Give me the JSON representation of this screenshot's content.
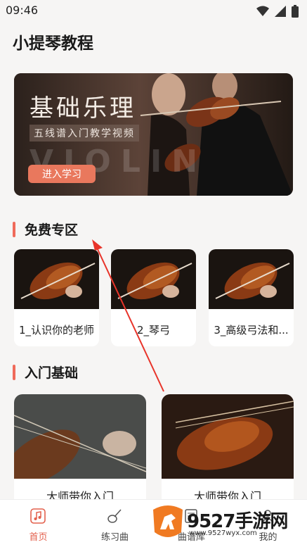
{
  "status": {
    "time": "09:46"
  },
  "app": {
    "title": "小提琴教程"
  },
  "banner": {
    "title": "基础乐理",
    "subtitle": "五线谱入门教学视频",
    "watermark": "VIOLIN",
    "button": "进入学习"
  },
  "free_section": {
    "title": "免费专区",
    "items": [
      {
        "label": "1_认识你的老师"
      },
      {
        "label": "2_琴弓"
      },
      {
        "label": "3_高级弓法和..."
      }
    ]
  },
  "basic_section": {
    "title": "入门基础",
    "items": [
      {
        "label": "大师带你入门"
      },
      {
        "label": "大师带你入门"
      }
    ]
  },
  "tabbar": {
    "items": [
      {
        "label": "首页",
        "icon": "music-note-icon",
        "active": true
      },
      {
        "label": "练习曲",
        "icon": "guitar-icon",
        "active": false
      },
      {
        "label": "曲谱库",
        "icon": "sheet-icon",
        "active": false
      },
      {
        "label": "我的",
        "icon": "user-icon",
        "active": false
      }
    ]
  },
  "watermark": {
    "text": "9527手游网",
    "url": "www.9527wyx.com"
  },
  "colors": {
    "accent": "#ef6a5a",
    "button": "#e9785d",
    "active_tab": "#e3604d",
    "arrow": "#e8342a"
  }
}
